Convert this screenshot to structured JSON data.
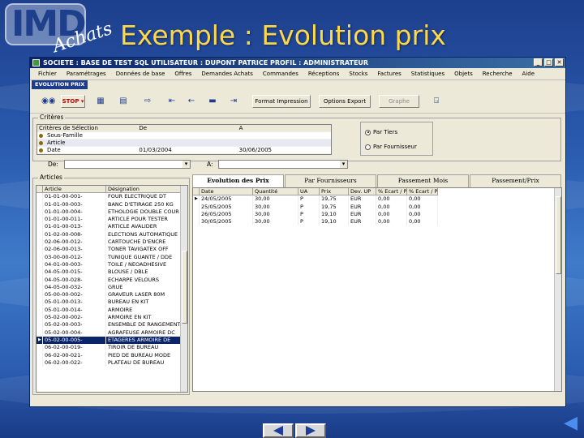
{
  "logo": {
    "main": "IMD",
    "sub": "Achats"
  },
  "slide_title": "Exemple : Evolution prix",
  "window": {
    "title": "SOCIETE : BASE DE TEST SQL   UTILISATEUR : DUPONT PATRICE   PROFIL : ADMINISTRATEUR",
    "controls": [
      "_",
      "□",
      "✕"
    ]
  },
  "menu": [
    "Fichier",
    "Paramétrages",
    "Données de base",
    "Offres",
    "Demandes Achats",
    "Commandes",
    "Réceptions",
    "Stocks",
    "Factures",
    "Statistiques",
    "Objets",
    "Recherche",
    "Aide"
  ],
  "doc_tab": "EVOLUTION PRIX",
  "toolbar": {
    "stop_label": "STOP",
    "print_button": "Format Impression",
    "options_button": "Options Export",
    "graph_button": "Graphe"
  },
  "criteres": {
    "label": "Critères",
    "headers": [
      "Critères de Sélection",
      "De",
      "A"
    ],
    "rows": [
      {
        "name": "Sous-Famille",
        "de": "",
        "a": ""
      },
      {
        "name": "Article",
        "de": "",
        "a": ""
      },
      {
        "name": "Date",
        "de": "01/03/2004",
        "a": "30/06/2005"
      }
    ],
    "radio": [
      {
        "label": "Par Tiers",
        "checked": true
      },
      {
        "label": "Par Fournisseur",
        "checked": false
      }
    ]
  },
  "de_label": "De:",
  "a_label": "A:",
  "articles": {
    "label": "Articles",
    "headers": [
      "Article",
      "Désignation"
    ],
    "rows": [
      [
        "01-01-00-001-",
        "FOUR ELECTRIQUE DT"
      ],
      [
        "01-01-00-003-",
        "BANC D'ETIRAGE 250 KG"
      ],
      [
        "01-01-00-004-",
        "ETHOLOGIE DOUBLE COUR"
      ],
      [
        "01-01-00-011-",
        "ARTICLE POUR TESTER"
      ],
      [
        "01-01-00-013-",
        "ARTICLE AVALIDER"
      ],
      [
        "01-02-00-008-",
        "ELECTIONS AUTOMATIQUE"
      ],
      [
        "02-06-00-012-",
        "CARTOUCHE D'ENCRE"
      ],
      [
        "02-06-00-013-",
        "TONER TAVIGATEX OFF"
      ],
      [
        "03-00-00-012-",
        "TUNIQUE GUANTE / DDE"
      ],
      [
        "04-01-00-003-",
        "TOILE / NEOADHESIVE"
      ],
      [
        "04-05-00-015-",
        "BLOUSE / DBLE"
      ],
      [
        "04-05-00-028-",
        "ECHARPE VELOURS"
      ],
      [
        "04-05-00-032-",
        "GRUE"
      ],
      [
        "05-00-00-002-",
        "GRAVEUR LASER 80M"
      ],
      [
        "05-01-00-013-",
        "BUREAU EN KIT"
      ],
      [
        "05-01-00-014-",
        "ARMOIRE"
      ],
      [
        "05-02-00-002-",
        "ARMOIRE EN KIT"
      ],
      [
        "05-02-00-003-",
        "ENSEMBLE DE RANGEMENT"
      ],
      [
        "05-02-00-004-",
        "AGRAFEUSE ARMOIRE DC"
      ],
      [
        "05-02-00-005-",
        "ETAGERES ARMOIRE DE"
      ],
      [
        "06-02-00-019-",
        "TIROIR DE BUREAU"
      ],
      [
        "06-02-00-021-",
        "PIED DE BUREAU MODE"
      ],
      [
        "06-02-00-022-",
        "PLATEAU DE BUREAU"
      ]
    ],
    "selected_index": 19
  },
  "tabs": [
    "Evolution des Prix",
    "Par Fournisseurs",
    "Passement Mois",
    "Passement/Prix"
  ],
  "prices": {
    "headers": [
      "Date",
      "Quantité",
      "UA",
      "Prix",
      "Dev. UP",
      "% Ecart / Préc",
      "% Ecart / Prem"
    ],
    "rows": [
      [
        "24/05/2005",
        "30,00",
        "P",
        "19,75",
        "EUR",
        "0,00",
        "0,00"
      ],
      [
        "25/05/2005",
        "30,00",
        "P",
        "19,75",
        "EUR",
        "0,00",
        "0,00"
      ],
      [
        "26/05/2005",
        "30,00",
        "P",
        "19,10",
        "EUR",
        "0,00",
        "0,00"
      ],
      [
        "30/05/2005",
        "30,00",
        "P",
        "19,10",
        "EUR",
        "0,00",
        "0,00"
      ]
    ]
  }
}
